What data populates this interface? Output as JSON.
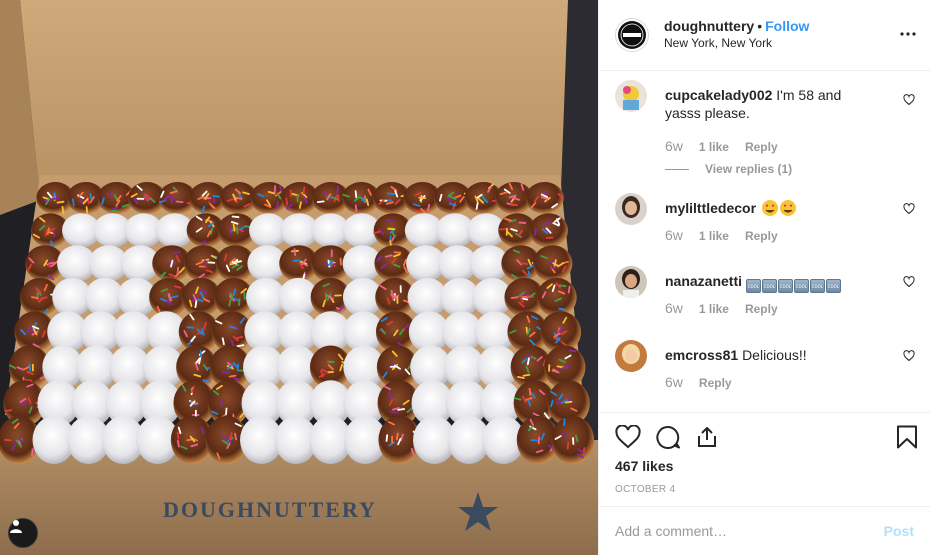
{
  "post": {
    "username": "doughnuttery",
    "separator": "•",
    "follow_label": "Follow",
    "location": "New York, New York",
    "more_icon": "more-options-icon",
    "box_brand_text": "DOUGHNUTTERY"
  },
  "comments": [
    {
      "username": "cupcakelady002",
      "text": "I'm 58 and yasss please.",
      "age": "6w",
      "likes": "1 like",
      "reply_label": "Reply",
      "view_replies": "View replies (1)"
    },
    {
      "username": "mylilttledecor",
      "text": "",
      "emoji": [
        "heart-eyes-emoji",
        "heart-eyes-emoji"
      ],
      "age": "6w",
      "likes": "1 like",
      "reply_label": "Reply"
    },
    {
      "username": "nanazanetti",
      "text": "",
      "emoji_label": "COOL",
      "emoji": [
        "cool-emoji",
        "cool-emoji",
        "cool-emoji",
        "cool-emoji",
        "cool-emoji",
        "cool-emoji"
      ],
      "age": "6w",
      "likes": "1 like",
      "reply_label": "Reply"
    },
    {
      "username": "emcross81",
      "text": "Delicious!!",
      "age": "6w",
      "reply_label": "Reply"
    }
  ],
  "actions": {
    "likes": "467 likes",
    "date": "OCTOBER 4"
  },
  "add_comment": {
    "placeholder": "Add a comment…",
    "post_label": "Post"
  },
  "colors": {
    "accent": "#3897f0",
    "post_disabled": "#b2dffc",
    "muted": "#999999",
    "text": "#262626"
  }
}
